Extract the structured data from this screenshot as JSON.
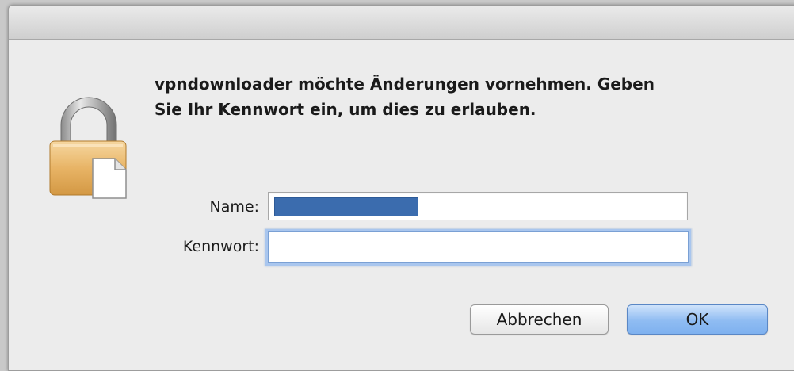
{
  "dialog": {
    "message_line1": "vpndownloader möchte Änderungen vornehmen. Geben",
    "message_line2": "Sie Ihr Kennwort ein, um dies zu erlauben.",
    "icon": "lock-icon"
  },
  "form": {
    "name_label": "Name:",
    "name_value": "",
    "password_label": "Kennwort:",
    "password_value": ""
  },
  "buttons": {
    "cancel_label": "Abbrechen",
    "ok_label": "OK"
  },
  "colors": {
    "default_button": "#8fbcf2",
    "focus_ring": "#a9c6ee",
    "redaction": "#3b6cae"
  }
}
